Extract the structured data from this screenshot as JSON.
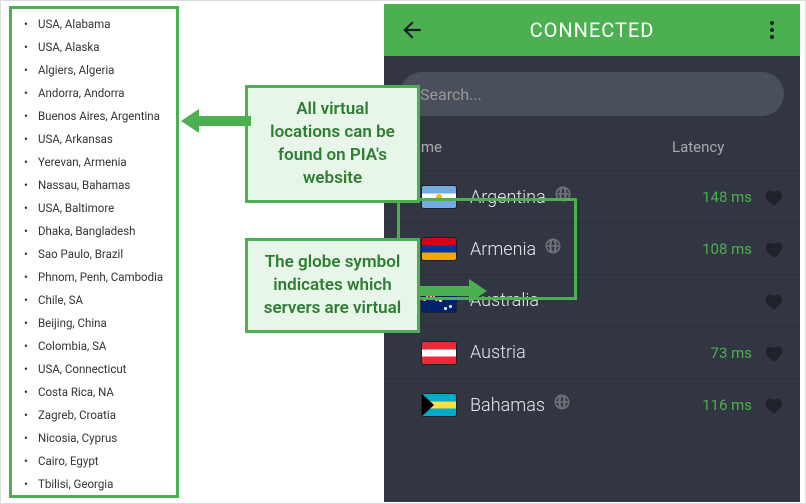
{
  "left_list": [
    "USA, Alabama",
    "USA, Alaska",
    "Algiers, Algeria",
    "Andorra, Andorra",
    "Buenos Aires, Argentina",
    "USA, Arkansas",
    "Yerevan, Armenia",
    "Nassau, Bahamas",
    "USA, Baltimore",
    "Dhaka, Bangladesh",
    "Sao Paulo, Brazil",
    "Phnom, Penh, Cambodia",
    "Chile, SA",
    "Beijing, China",
    "Colombia, SA",
    "USA, Connecticut",
    "Costa Rica, NA",
    "Zagreb, Croatia",
    "Nicosia, Cyprus",
    "Cairo, Egypt",
    "Tbilisi, Georgia"
  ],
  "app": {
    "header_title": "CONNECTED",
    "search_placeholder": "Search...",
    "columns": {
      "name": "Name",
      "latency": "Latency"
    },
    "servers": [
      {
        "name": "Argentina",
        "flag": "ar",
        "virtual": true,
        "expandable": false,
        "latency": "148 ms"
      },
      {
        "name": "Armenia",
        "flag": "am",
        "virtual": true,
        "expandable": false,
        "latency": "108 ms"
      },
      {
        "name": "Australia",
        "flag": "au",
        "virtual": false,
        "expandable": true,
        "latency": ""
      },
      {
        "name": "Austria",
        "flag": "at",
        "virtual": false,
        "expandable": false,
        "latency": "73 ms"
      },
      {
        "name": "Bahamas",
        "flag": "bs",
        "virtual": true,
        "expandable": false,
        "latency": "116 ms"
      }
    ]
  },
  "callouts": {
    "c1": "All virtual locations can be found on PIA's website",
    "c2": "The globe symbol indicates which servers are virtual"
  }
}
